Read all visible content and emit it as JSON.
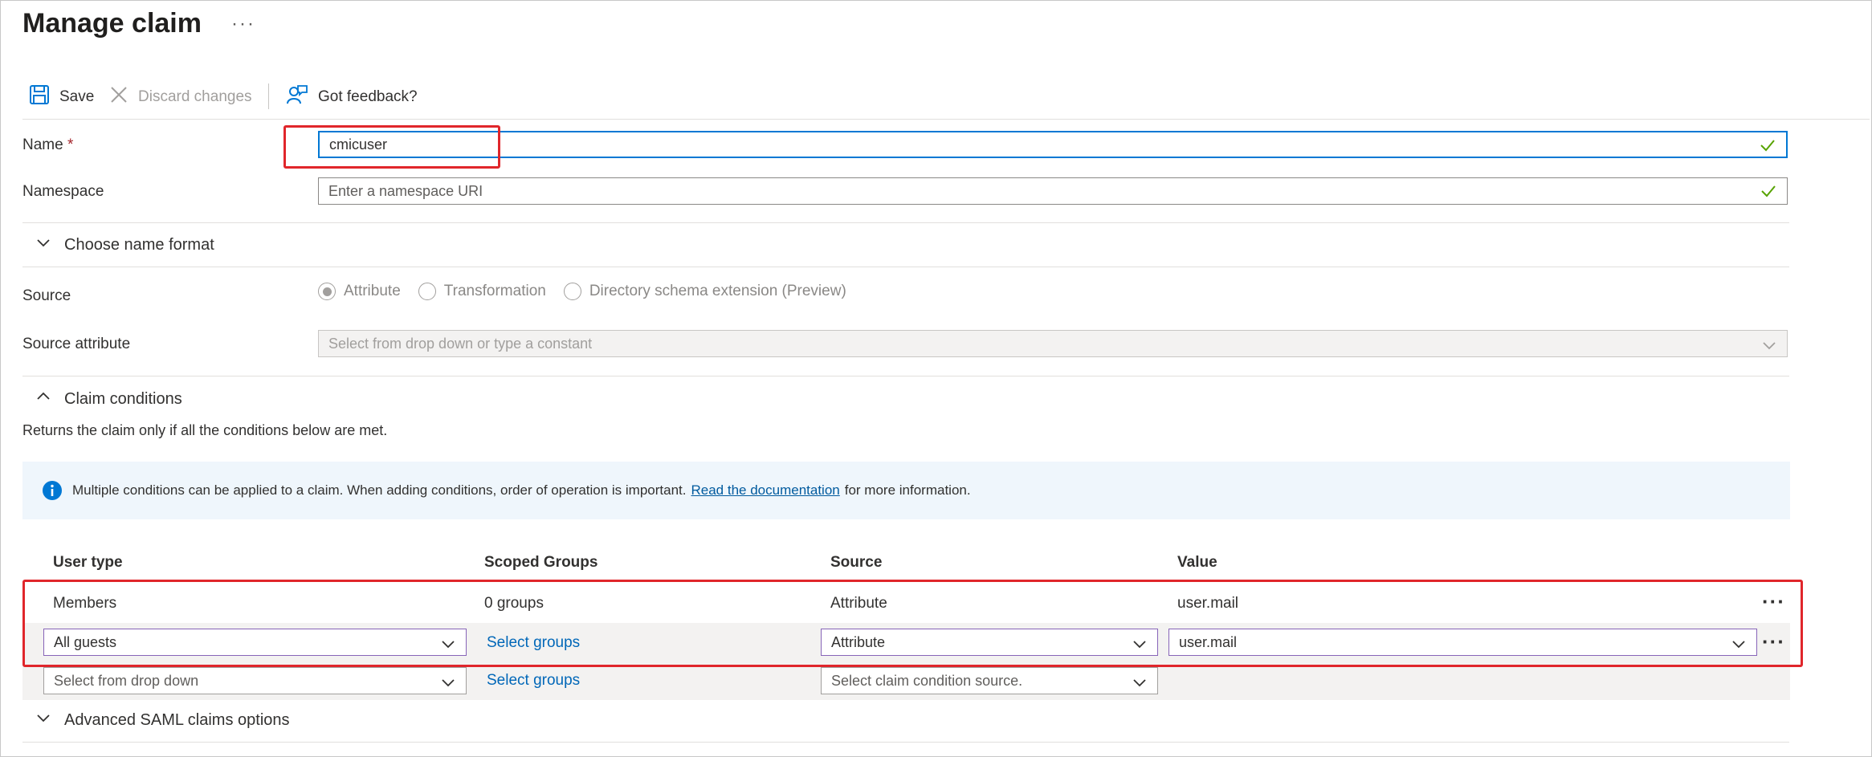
{
  "page": {
    "title": "Manage claim",
    "more": "···"
  },
  "toolbar": {
    "save": "Save",
    "discard": "Discard changes",
    "feedback": "Got feedback?"
  },
  "form": {
    "name_label": "Name",
    "required_mark": "*",
    "name_value": "cmicuser",
    "namespace_label": "Namespace",
    "namespace_placeholder": "Enter a namespace URI",
    "name_format": "Choose name format",
    "source_label": "Source",
    "source_options": [
      "Attribute",
      "Transformation",
      "Directory schema extension (Preview)"
    ],
    "source_selected": "Attribute",
    "source_attribute_label": "Source attribute",
    "source_attribute_placeholder": "Select from drop down or type a constant"
  },
  "conditions": {
    "header": "Claim conditions",
    "description": "Returns the claim only if all the conditions below are met.",
    "info_text": "Multiple conditions can be applied to a claim.  When adding conditions, order of operation is important.",
    "info_link": "Read the documentation",
    "info_suffix": "for more information.",
    "columns": [
      "User type",
      "Scoped Groups",
      "Source",
      "Value"
    ],
    "rows": [
      {
        "user_type": "Members",
        "groups": "0 groups",
        "source": "Attribute",
        "value": "user.mail"
      },
      {
        "user_type": "All guests",
        "groups": "Select groups",
        "source": "Attribute",
        "value": "user.mail"
      }
    ],
    "new_row": {
      "user_type_placeholder": "Select from drop down",
      "groups": "Select groups",
      "source_placeholder": "Select claim condition source."
    },
    "more": "···"
  },
  "advanced": "Advanced SAML claims options",
  "colors": {
    "accent": "#0078d4",
    "highlight": "#e0262b",
    "link": "#0067b8",
    "valid": "#57a300"
  }
}
